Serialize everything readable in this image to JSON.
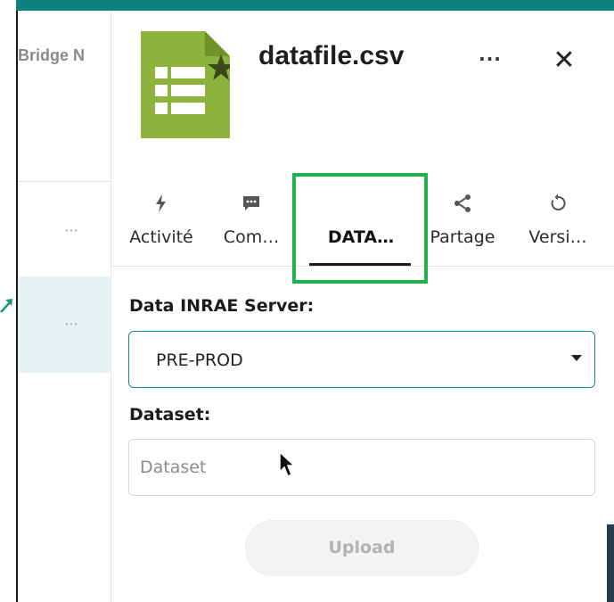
{
  "app": {
    "accent_color": "#0f8080",
    "highlight_color": "#22b04b",
    "file_icon_color": "#8cb33c"
  },
  "left_pane": {
    "header": "Bridge N",
    "rows": [
      {
        "more_label": "···"
      },
      {
        "more_label": "···",
        "selected": true
      }
    ]
  },
  "sidebar": {
    "file_name": "datafile.csv",
    "file_icon": "spreadsheet-icon",
    "favorite_icon": "star-icon",
    "more_label": "···",
    "close_label": "✕",
    "tabs": [
      {
        "label": "Activité",
        "icon": "lightning-icon"
      },
      {
        "label": "Com…",
        "icon": "comment-icon"
      },
      {
        "label": "DATA…",
        "icon": "",
        "active": true
      },
      {
        "label": "Partage",
        "icon": "share-icon"
      },
      {
        "label": "Versi…",
        "icon": "history-icon"
      }
    ]
  },
  "form": {
    "server_label": "Data INRAE Server:",
    "server_value": "PRE-PROD",
    "dataset_label": "Dataset:",
    "dataset_placeholder": "Dataset",
    "dataset_value": "",
    "upload_label": "Upload"
  }
}
